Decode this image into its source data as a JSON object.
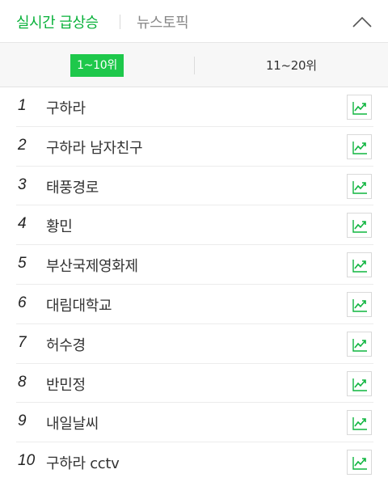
{
  "header": {
    "tab_realtime": "실시간 급상승",
    "tab_newstopic": "뉴스토픽",
    "collapse_icon": "chevron-up-icon"
  },
  "range": {
    "active_label": "1~10위",
    "other_label": "11~20위"
  },
  "accent_color": "#08b13a",
  "trend_icon": "trend-chart-icon",
  "items": [
    {
      "rank": "1",
      "keyword": "구하라"
    },
    {
      "rank": "2",
      "keyword": "구하라 남자친구"
    },
    {
      "rank": "3",
      "keyword": "태풍경로"
    },
    {
      "rank": "4",
      "keyword": "황민"
    },
    {
      "rank": "5",
      "keyword": "부산국제영화제"
    },
    {
      "rank": "6",
      "keyword": "대림대학교"
    },
    {
      "rank": "7",
      "keyword": "허수경"
    },
    {
      "rank": "8",
      "keyword": "반민정"
    },
    {
      "rank": "9",
      "keyword": "내일날씨"
    },
    {
      "rank": "10",
      "keyword": "구하라 cctv"
    }
  ]
}
